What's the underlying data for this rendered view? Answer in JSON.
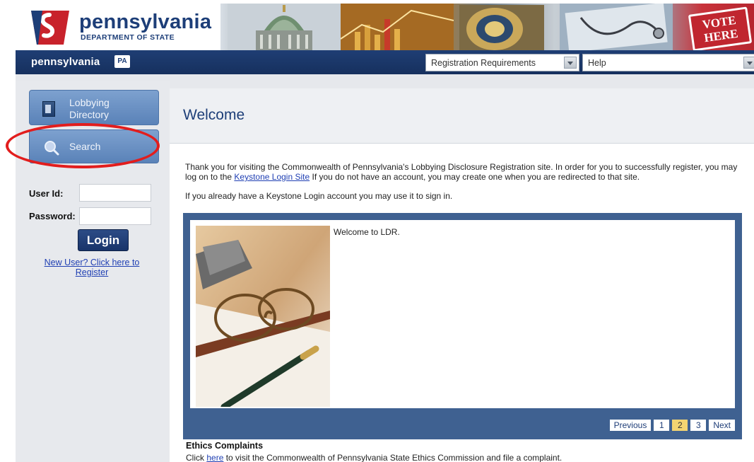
{
  "header": {
    "brand_name": "pennsylvania",
    "brand_sub": "DEPARTMENT OF STATE",
    "vote_line1": "VOTE",
    "vote_line2": "HERE"
  },
  "nav": {
    "logo_text": "pennsylvania",
    "logo_badge": "PA",
    "dropdown_registration": "Registration Requirements",
    "dropdown_help": "Help"
  },
  "sidebar": {
    "lobbying_directory_line1": "Lobbying",
    "lobbying_directory_line2": "Directory",
    "search_label": "Search",
    "user_id_label": "User Id:",
    "password_label": "Password:",
    "user_id_value": "",
    "password_value": "",
    "login_label": "Login",
    "register_line1": "New User? Click here to",
    "register_line2": "Register"
  },
  "main": {
    "title": "Welcome",
    "intro_part1": "Thank you for visiting the Commonwealth of Pennsylvania's Lobbying Disclosure Registration site. In order for you to successfully register, you may log on to the",
    "intro_link": "Keystone Login Site",
    "intro_part2": " If you do not have an account, you may create one when you are redirected to that site.",
    "intro_line2": "If you already have a Keystone Login account you may use it to sign in.",
    "slide_text": "Welcome to LDR.",
    "pager": {
      "previous": "Previous",
      "pages": [
        "1",
        "2",
        "3"
      ],
      "active_page": "2",
      "next": "Next"
    },
    "ethics": {
      "title": "Ethics Complaints",
      "text_prefix": "Click ",
      "link": "here",
      "text_suffix": "  to visit the Commonwealth of Pennsylvania State Ethics Commission and file a complaint."
    }
  },
  "colors": {
    "brand_navy": "#1d3e78",
    "nav_bar": "#1a3566",
    "sidebar_button": "#6f94c6",
    "highlight_ring": "#e21d1d",
    "active_page": "#f3d572"
  }
}
